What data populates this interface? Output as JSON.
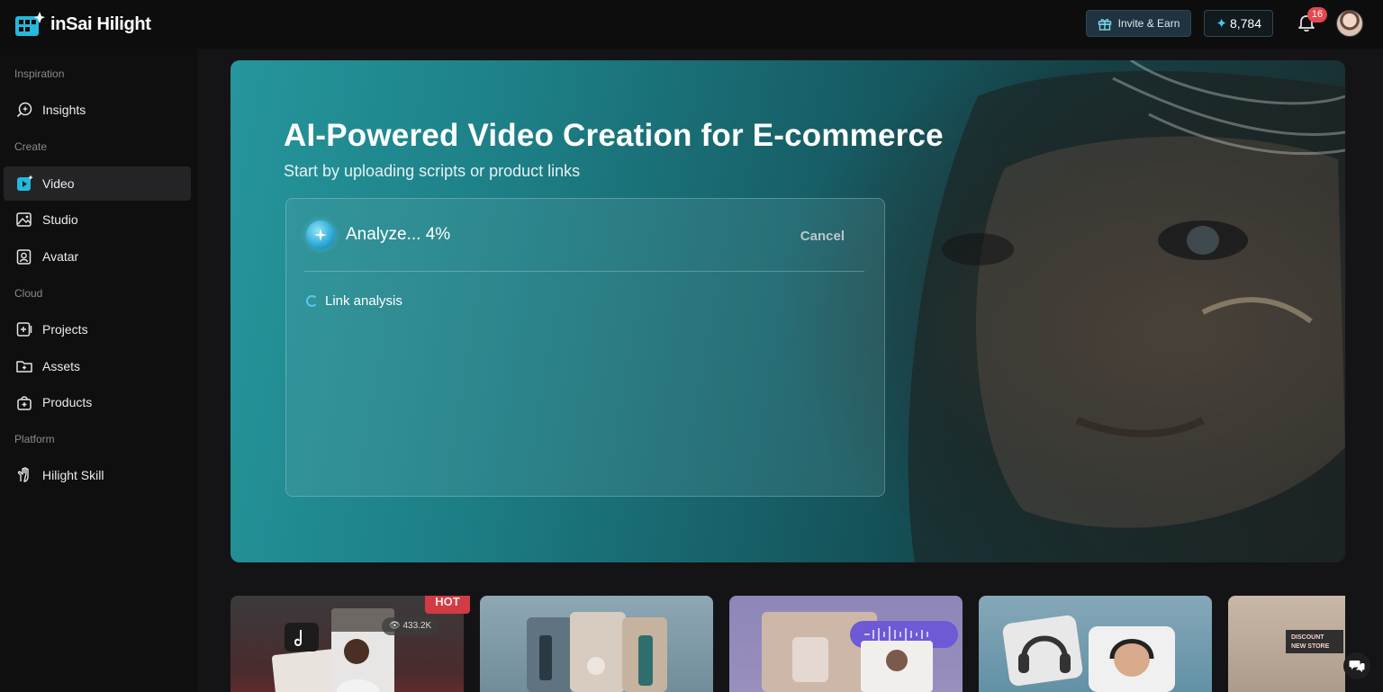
{
  "app": {
    "name": "inSai Hilight"
  },
  "header": {
    "invite_label": "Invite & Earn",
    "credits": "8,784",
    "notification_count": "16"
  },
  "sidebar": {
    "sections": [
      {
        "label": "Inspiration",
        "items": [
          {
            "label": "Insights",
            "icon": "insights-icon"
          }
        ]
      },
      {
        "label": "Create",
        "items": [
          {
            "label": "Video",
            "icon": "video-icon",
            "active": true
          },
          {
            "label": "Studio",
            "icon": "image-icon"
          },
          {
            "label": "Avatar",
            "icon": "avatar-icon"
          }
        ]
      },
      {
        "label": "Cloud",
        "items": [
          {
            "label": "Projects",
            "icon": "projects-icon"
          },
          {
            "label": "Assets",
            "icon": "folder-icon"
          },
          {
            "label": "Products",
            "icon": "bag-icon"
          }
        ]
      },
      {
        "label": "Platform",
        "items": [
          {
            "label": "Hilight Skill",
            "icon": "hand-icon"
          }
        ]
      }
    ]
  },
  "hero": {
    "title": "AI-Powered Video Creation for E-commerce",
    "subtitle": "Start by uploading scripts or product links"
  },
  "analysis": {
    "status": "Analyze... 4%",
    "progress_percent": 4,
    "cancel_label": "Cancel",
    "steps": [
      {
        "label": "Link analysis",
        "state": "loading"
      }
    ]
  },
  "templates": {
    "hot_label": "HOT",
    "views": "433.2K",
    "discount_label": "DISCOUNT NEW STORE"
  },
  "colors": {
    "accent": "#41c9e8",
    "hot": "#d13b45",
    "badge": "#e5484d"
  }
}
